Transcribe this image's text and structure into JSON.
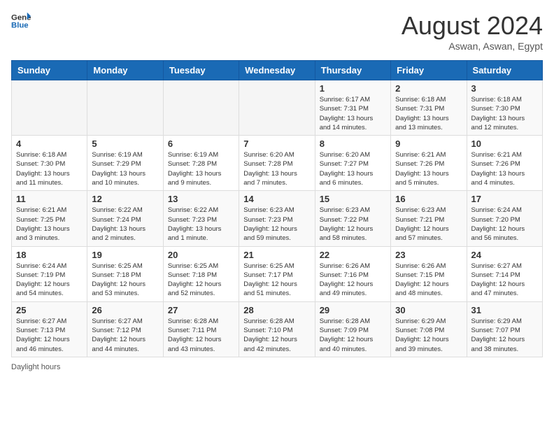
{
  "header": {
    "logo_general": "General",
    "logo_blue": "Blue",
    "month_title": "August 2024",
    "location": "Aswan, Aswan, Egypt"
  },
  "days_of_week": [
    "Sunday",
    "Monday",
    "Tuesday",
    "Wednesday",
    "Thursday",
    "Friday",
    "Saturday"
  ],
  "weeks": [
    [
      {
        "day": "",
        "info": ""
      },
      {
        "day": "",
        "info": ""
      },
      {
        "day": "",
        "info": ""
      },
      {
        "day": "",
        "info": ""
      },
      {
        "day": "1",
        "info": "Sunrise: 6:17 AM\nSunset: 7:31 PM\nDaylight: 13 hours\nand 14 minutes."
      },
      {
        "day": "2",
        "info": "Sunrise: 6:18 AM\nSunset: 7:31 PM\nDaylight: 13 hours\nand 13 minutes."
      },
      {
        "day": "3",
        "info": "Sunrise: 6:18 AM\nSunset: 7:30 PM\nDaylight: 13 hours\nand 12 minutes."
      }
    ],
    [
      {
        "day": "4",
        "info": "Sunrise: 6:18 AM\nSunset: 7:30 PM\nDaylight: 13 hours\nand 11 minutes."
      },
      {
        "day": "5",
        "info": "Sunrise: 6:19 AM\nSunset: 7:29 PM\nDaylight: 13 hours\nand 10 minutes."
      },
      {
        "day": "6",
        "info": "Sunrise: 6:19 AM\nSunset: 7:28 PM\nDaylight: 13 hours\nand 9 minutes."
      },
      {
        "day": "7",
        "info": "Sunrise: 6:20 AM\nSunset: 7:28 PM\nDaylight: 13 hours\nand 7 minutes."
      },
      {
        "day": "8",
        "info": "Sunrise: 6:20 AM\nSunset: 7:27 PM\nDaylight: 13 hours\nand 6 minutes."
      },
      {
        "day": "9",
        "info": "Sunrise: 6:21 AM\nSunset: 7:26 PM\nDaylight: 13 hours\nand 5 minutes."
      },
      {
        "day": "10",
        "info": "Sunrise: 6:21 AM\nSunset: 7:26 PM\nDaylight: 13 hours\nand 4 minutes."
      }
    ],
    [
      {
        "day": "11",
        "info": "Sunrise: 6:21 AM\nSunset: 7:25 PM\nDaylight: 13 hours\nand 3 minutes."
      },
      {
        "day": "12",
        "info": "Sunrise: 6:22 AM\nSunset: 7:24 PM\nDaylight: 13 hours\nand 2 minutes."
      },
      {
        "day": "13",
        "info": "Sunrise: 6:22 AM\nSunset: 7:23 PM\nDaylight: 13 hours\nand 1 minute."
      },
      {
        "day": "14",
        "info": "Sunrise: 6:23 AM\nSunset: 7:23 PM\nDaylight: 12 hours\nand 59 minutes."
      },
      {
        "day": "15",
        "info": "Sunrise: 6:23 AM\nSunset: 7:22 PM\nDaylight: 12 hours\nand 58 minutes."
      },
      {
        "day": "16",
        "info": "Sunrise: 6:23 AM\nSunset: 7:21 PM\nDaylight: 12 hours\nand 57 minutes."
      },
      {
        "day": "17",
        "info": "Sunrise: 6:24 AM\nSunset: 7:20 PM\nDaylight: 12 hours\nand 56 minutes."
      }
    ],
    [
      {
        "day": "18",
        "info": "Sunrise: 6:24 AM\nSunset: 7:19 PM\nDaylight: 12 hours\nand 54 minutes."
      },
      {
        "day": "19",
        "info": "Sunrise: 6:25 AM\nSunset: 7:18 PM\nDaylight: 12 hours\nand 53 minutes."
      },
      {
        "day": "20",
        "info": "Sunrise: 6:25 AM\nSunset: 7:18 PM\nDaylight: 12 hours\nand 52 minutes."
      },
      {
        "day": "21",
        "info": "Sunrise: 6:25 AM\nSunset: 7:17 PM\nDaylight: 12 hours\nand 51 minutes."
      },
      {
        "day": "22",
        "info": "Sunrise: 6:26 AM\nSunset: 7:16 PM\nDaylight: 12 hours\nand 49 minutes."
      },
      {
        "day": "23",
        "info": "Sunrise: 6:26 AM\nSunset: 7:15 PM\nDaylight: 12 hours\nand 48 minutes."
      },
      {
        "day": "24",
        "info": "Sunrise: 6:27 AM\nSunset: 7:14 PM\nDaylight: 12 hours\nand 47 minutes."
      }
    ],
    [
      {
        "day": "25",
        "info": "Sunrise: 6:27 AM\nSunset: 7:13 PM\nDaylight: 12 hours\nand 46 minutes."
      },
      {
        "day": "26",
        "info": "Sunrise: 6:27 AM\nSunset: 7:12 PM\nDaylight: 12 hours\nand 44 minutes."
      },
      {
        "day": "27",
        "info": "Sunrise: 6:28 AM\nSunset: 7:11 PM\nDaylight: 12 hours\nand 43 minutes."
      },
      {
        "day": "28",
        "info": "Sunrise: 6:28 AM\nSunset: 7:10 PM\nDaylight: 12 hours\nand 42 minutes."
      },
      {
        "day": "29",
        "info": "Sunrise: 6:28 AM\nSunset: 7:09 PM\nDaylight: 12 hours\nand 40 minutes."
      },
      {
        "day": "30",
        "info": "Sunrise: 6:29 AM\nSunset: 7:08 PM\nDaylight: 12 hours\nand 39 minutes."
      },
      {
        "day": "31",
        "info": "Sunrise: 6:29 AM\nSunset: 7:07 PM\nDaylight: 12 hours\nand 38 minutes."
      }
    ]
  ],
  "footer": {
    "daylight_hours_label": "Daylight hours"
  }
}
